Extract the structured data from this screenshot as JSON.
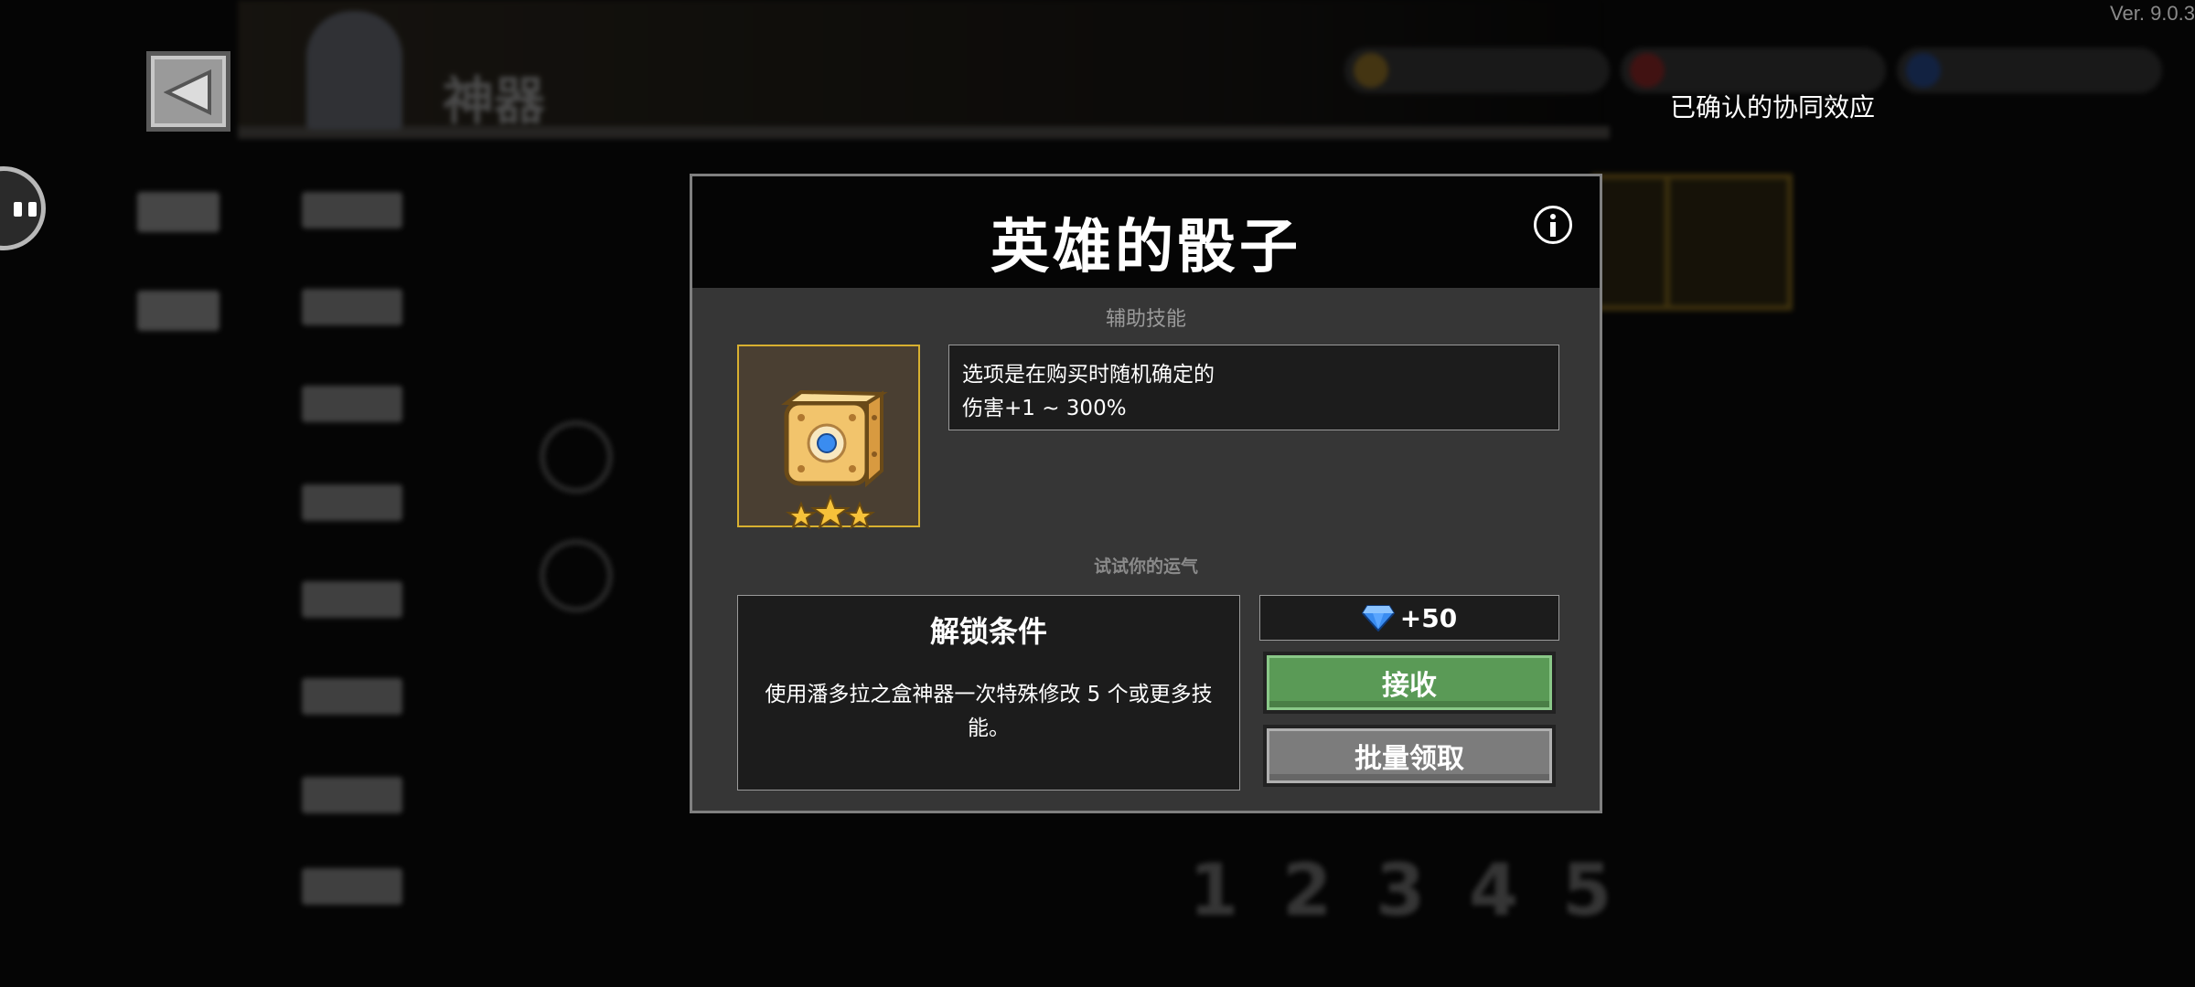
{
  "version": "Ver. 9.0.3",
  "synergy_label": "已确认的协同效应",
  "background": {
    "title": "神器",
    "page_numbers": [
      "1",
      "2",
      "3",
      "4",
      "5"
    ]
  },
  "dialog": {
    "title": "英雄的骰子",
    "category": "辅助技能",
    "item_icon": "hero-dice-icon",
    "stars": 3,
    "description": [
      "选项是在购买时随机确定的",
      "伤害+1 ~ 300%"
    ],
    "luck_label": "试试你的运气",
    "unlock": {
      "title": "解锁条件",
      "description": "使用潘多拉之盒神器一次特殊修改 5 个或更多技能。"
    },
    "reward": {
      "icon": "gem-icon",
      "text": "+50"
    },
    "buttons": {
      "receive": "接收",
      "batch": "批量领取"
    }
  },
  "colors": {
    "receive_button": "#5a9a56",
    "batch_button": "#7c7c7c",
    "item_frame_border": "#d8b030",
    "gem": "#3a8cf0"
  }
}
